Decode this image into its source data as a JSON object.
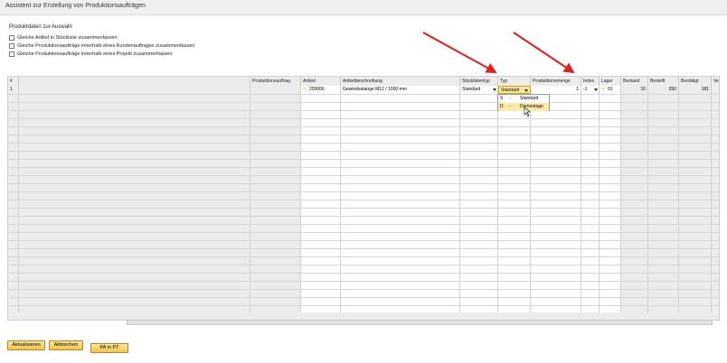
{
  "window": {
    "title": "Assistent zur Erstellung von Produktionsaufträgen"
  },
  "selection": {
    "title": "Produktdaten zur Auswahl",
    "options": [
      {
        "label": "Gleiche Artikel in Stückliste zusammenfassen",
        "checked": false
      },
      {
        "label": "Gleiche Produktionsaufträge innerhalb eines Kundenauftrages zusammenfassen",
        "checked": false
      },
      {
        "label": "Gleiche Produktionsaufträge innerhalb eines Projekt zusammenfassen",
        "checked": false
      }
    ]
  },
  "grid": {
    "headers": {
      "num": "#",
      "produktionsauftrag": "Produktionsauftrag",
      "artikel": "Artikel",
      "artikelbeschreibung": "Artikelbeschreibung",
      "stuecklistentyp": "Stücklistentyp",
      "typ": "Typ",
      "produktionsmenge": "Produktionsmenge",
      "index": "Index",
      "lager": "Lager",
      "bestand": "Bestand",
      "bestellt": "Bestellt",
      "bestaetigt": "Bestätigt",
      "verfuegbar": "Verf"
    },
    "row1": {
      "num": "1",
      "artikel": "200006",
      "artikelbeschreibung": "Gewindestange M12 / 1000 mm",
      "stuecklistentyp": "Standard",
      "typ": "Standard",
      "produktionsmenge": "1",
      "index": "-1",
      "lager": "01",
      "bestand": "10",
      "bestellt": "250",
      "bestaetigt": "181"
    }
  },
  "dropdown": {
    "items": [
      {
        "key": "S",
        "sep": "-",
        "label": "Standard"
      },
      {
        "key": "D",
        "sep": "-",
        "label": "Demontage"
      }
    ]
  },
  "buttons": {
    "aktualisieren": "Aktualisieren",
    "abbrechen": "Abbrechen",
    "pa_in_pt": "PA in PT"
  },
  "colors": {
    "annotation_arrow": "#e02020",
    "button_gold": "#f3c545",
    "link_arrow": "#e8a100"
  }
}
